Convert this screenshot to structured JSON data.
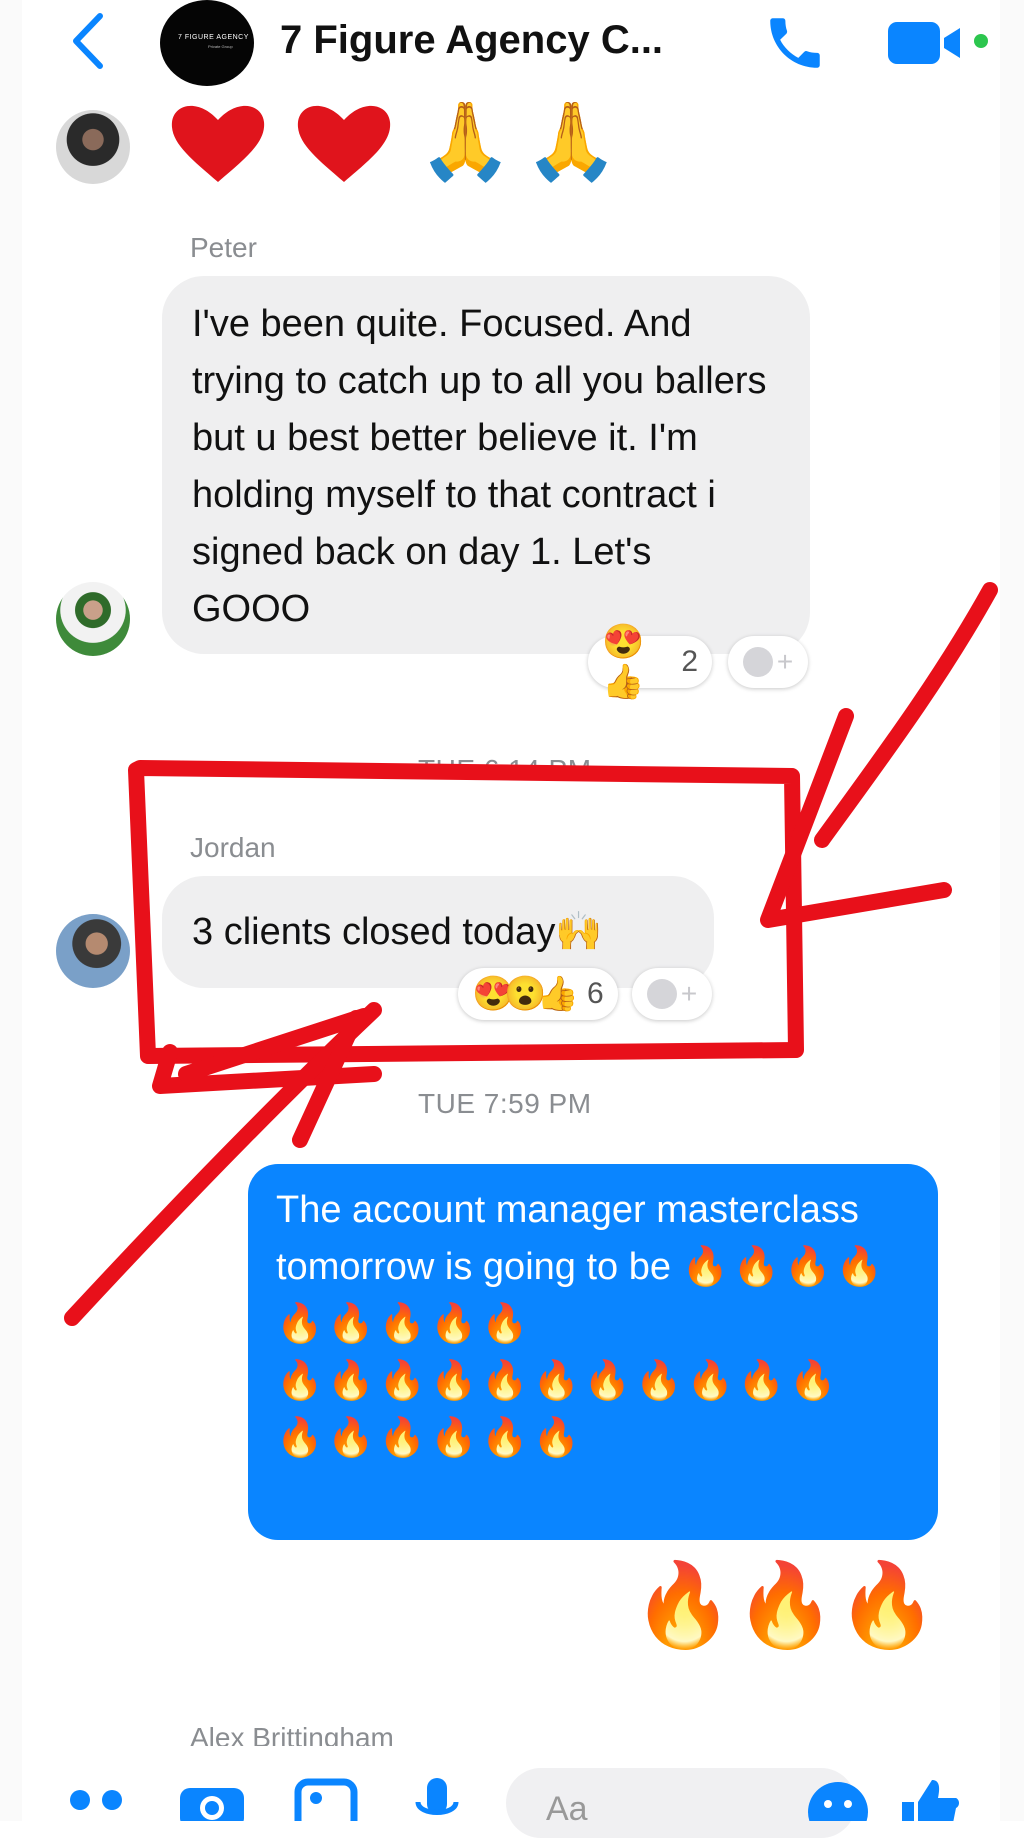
{
  "header": {
    "title": "7 Figure Agency C...",
    "logo_text": "7 FIGURE AGENCY",
    "logo_sub": "Private Group"
  },
  "top_reactions": [
    "❤️",
    "❤️",
    "🙏",
    "🙏"
  ],
  "messages": [
    {
      "sender": "Peter",
      "text": "I've been quite. Focused. And trying to catch up to all you ballers but u best better believe it. I'm holding myself to that contract i signed back on day 1. Let's GOOO",
      "reaction_emojis": "😍👍",
      "reaction_count": "2"
    },
    {
      "timestamp": "TUE 6:14 PM",
      "sender": "Jordan",
      "text": "3 clients closed today🙌",
      "reaction_emojis": "😍😮👍",
      "reaction_count": "6"
    },
    {
      "timestamp": "TUE 7:59 PM",
      "outgoing_text": "The account manager masterclass tomorrow is going to be",
      "outgoing_fires": "🔥🔥🔥🔥🔥🔥🔥🔥🔥",
      "outgoing_fires2": "🔥🔥🔥🔥🔥🔥🔥🔥🔥🔥🔥",
      "outgoing_fires3": "🔥🔥🔥🔥🔥🔥",
      "big_fires": "🔥🔥🔥"
    },
    {
      "sender": "Alex Brittingham"
    }
  ],
  "composer": {
    "placeholder": "Aa"
  },
  "add_reaction_label": "+",
  "colors": {
    "accent": "#0a85ff",
    "annotation": "#e8101a",
    "online": "#2cc64e"
  },
  "icons": [
    "back-icon",
    "phone-icon",
    "video-icon",
    "apps-icon",
    "camera-icon",
    "gallery-icon",
    "mic-icon",
    "emoji-icon",
    "like-icon"
  ]
}
